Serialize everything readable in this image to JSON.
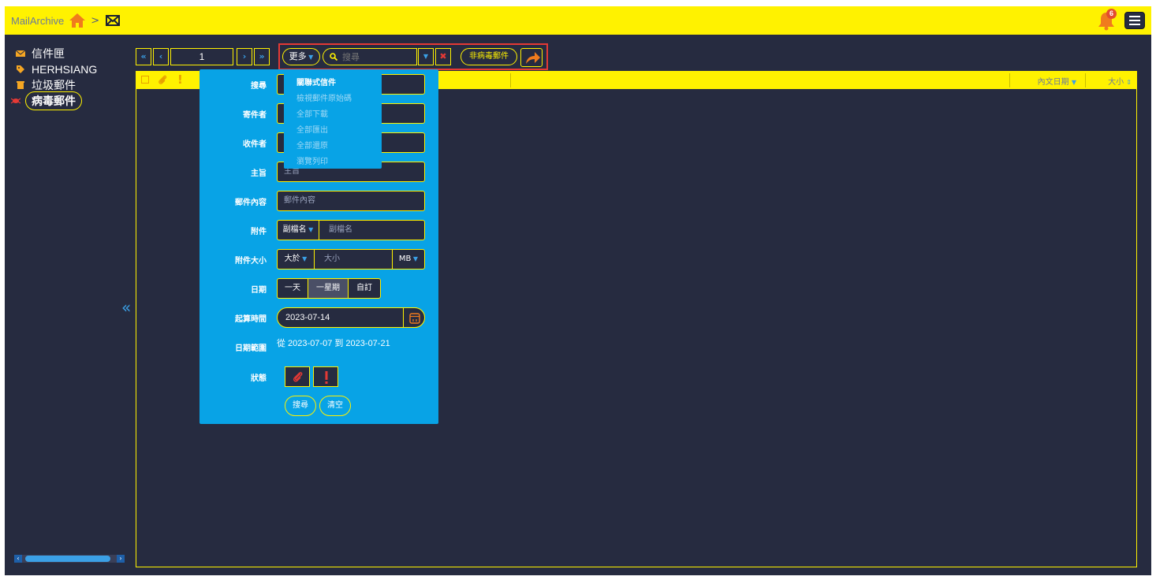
{
  "app": {
    "brand": "MailArchive",
    "breadcrumb_sep": ">"
  },
  "notifications": {
    "count": "6"
  },
  "sidebar": {
    "items": [
      {
        "label": "信件匣",
        "icon": "envelope-icon"
      },
      {
        "label": "HERHSIANG",
        "icon": "tag-icon"
      },
      {
        "label": "垃圾郵件",
        "icon": "trash-icon"
      },
      {
        "label": "病毒郵件",
        "icon": "bug-icon",
        "active": true
      }
    ],
    "collapse": "«"
  },
  "toolbar": {
    "first": "«",
    "prev": "‹",
    "page": "1",
    "next": "›",
    "last": "»",
    "more_label": "更多",
    "search_placeholder": "搜尋",
    "non_virus_label": "非病毒郵件",
    "forward_tooltip": "轉寄"
  },
  "list": {
    "col_date": "內文日期",
    "col_size": "大小"
  },
  "search_panel": {
    "search_label": "搜尋",
    "sender_label": "寄件者",
    "recipient_label": "收件者",
    "subject_label": "主旨",
    "subject_placeholder": "主旨",
    "content_label": "郵件內容",
    "content_placeholder": "郵件內容",
    "attach_label": "附件",
    "attach_type": "副檔名",
    "attach_placeholder": "副檔名",
    "attach_size_label": "附件大小",
    "size_op": "大於",
    "size_placeholder": "大小",
    "size_unit": "MB",
    "date_label": "日期",
    "date_options": [
      "一天",
      "一星期",
      "自訂"
    ],
    "date_selected": "一星期",
    "start_label": "起算時間",
    "start_value": "2023-07-14",
    "range_label": "日期範圍",
    "range_value": "從 2023-07-07 到 2023-07-21",
    "status_label": "狀態",
    "search_button": "搜尋",
    "clear_button": "清空"
  },
  "more_menu": {
    "items": [
      "關聯式信件",
      "檢視郵件原始碼",
      "全部下載",
      "全部匯出",
      "全部還原",
      "瀏覽列印"
    ]
  },
  "colors": {
    "accent": "#fff200",
    "panel": "#08a3e6",
    "bg": "#262b40",
    "danger": "#e53935",
    "orange": "#f07b1d"
  }
}
